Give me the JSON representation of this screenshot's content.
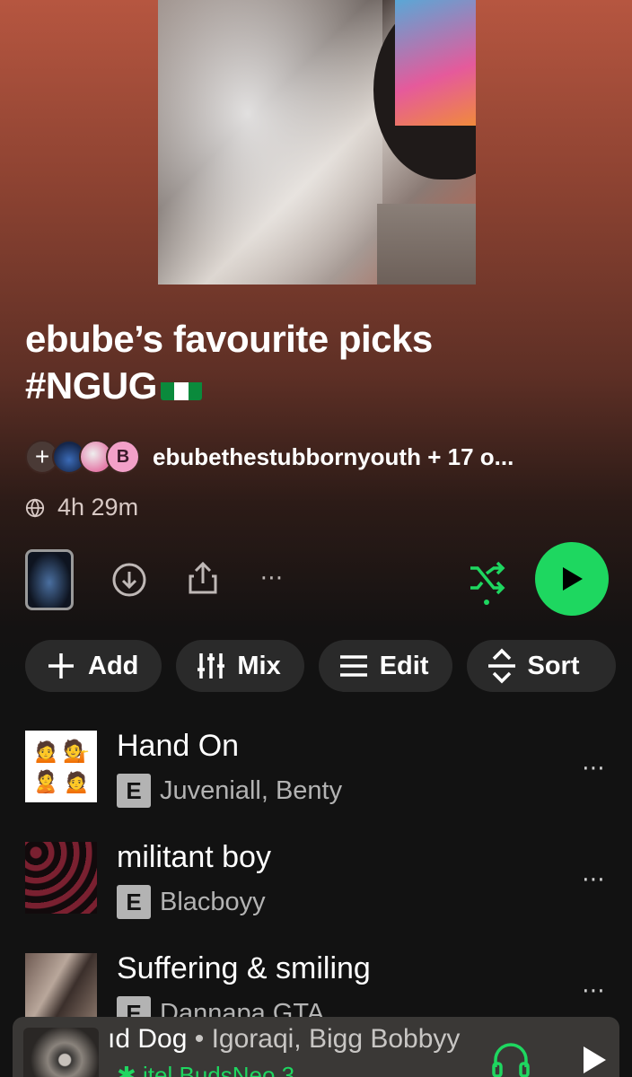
{
  "playlist": {
    "title_line1": "ebube’s favourite picks",
    "title_line2": "#NGUG",
    "owner_text": "ebubethestubbornyouth + 17 o...",
    "avatar_letter": "B",
    "duration": "4h 29m"
  },
  "actions": {
    "download_icon": "download-icon",
    "share_icon": "share-icon",
    "more_icon": "more-icon",
    "shuffle_icon": "shuffle-icon",
    "play_icon": "play-icon"
  },
  "chips": [
    {
      "label": "Add",
      "icon": "plus-icon"
    },
    {
      "label": "Mix",
      "icon": "mix-icon"
    },
    {
      "label": "Edit",
      "icon": "list-icon"
    },
    {
      "label": "Sort",
      "icon": "sort-icon"
    }
  ],
  "tracks": [
    {
      "title": "Hand On",
      "explicit": "E",
      "artists": "Juveniall, Benty"
    },
    {
      "title": "militant boy",
      "explicit": "E",
      "artists": "Blacboyy"
    },
    {
      "title": "Suffering & smiling",
      "explicit": "E",
      "artists": "Dannapa GTA"
    }
  ],
  "now_playing": {
    "title": "ıd Dog",
    "separator": " • ",
    "artists": "Igoraqi, Bigg Bobbyy",
    "device": "itel BudsNeo 3"
  },
  "colors": {
    "accent_green": "#1ed760",
    "header_top": "#b65640",
    "background": "#121212"
  }
}
